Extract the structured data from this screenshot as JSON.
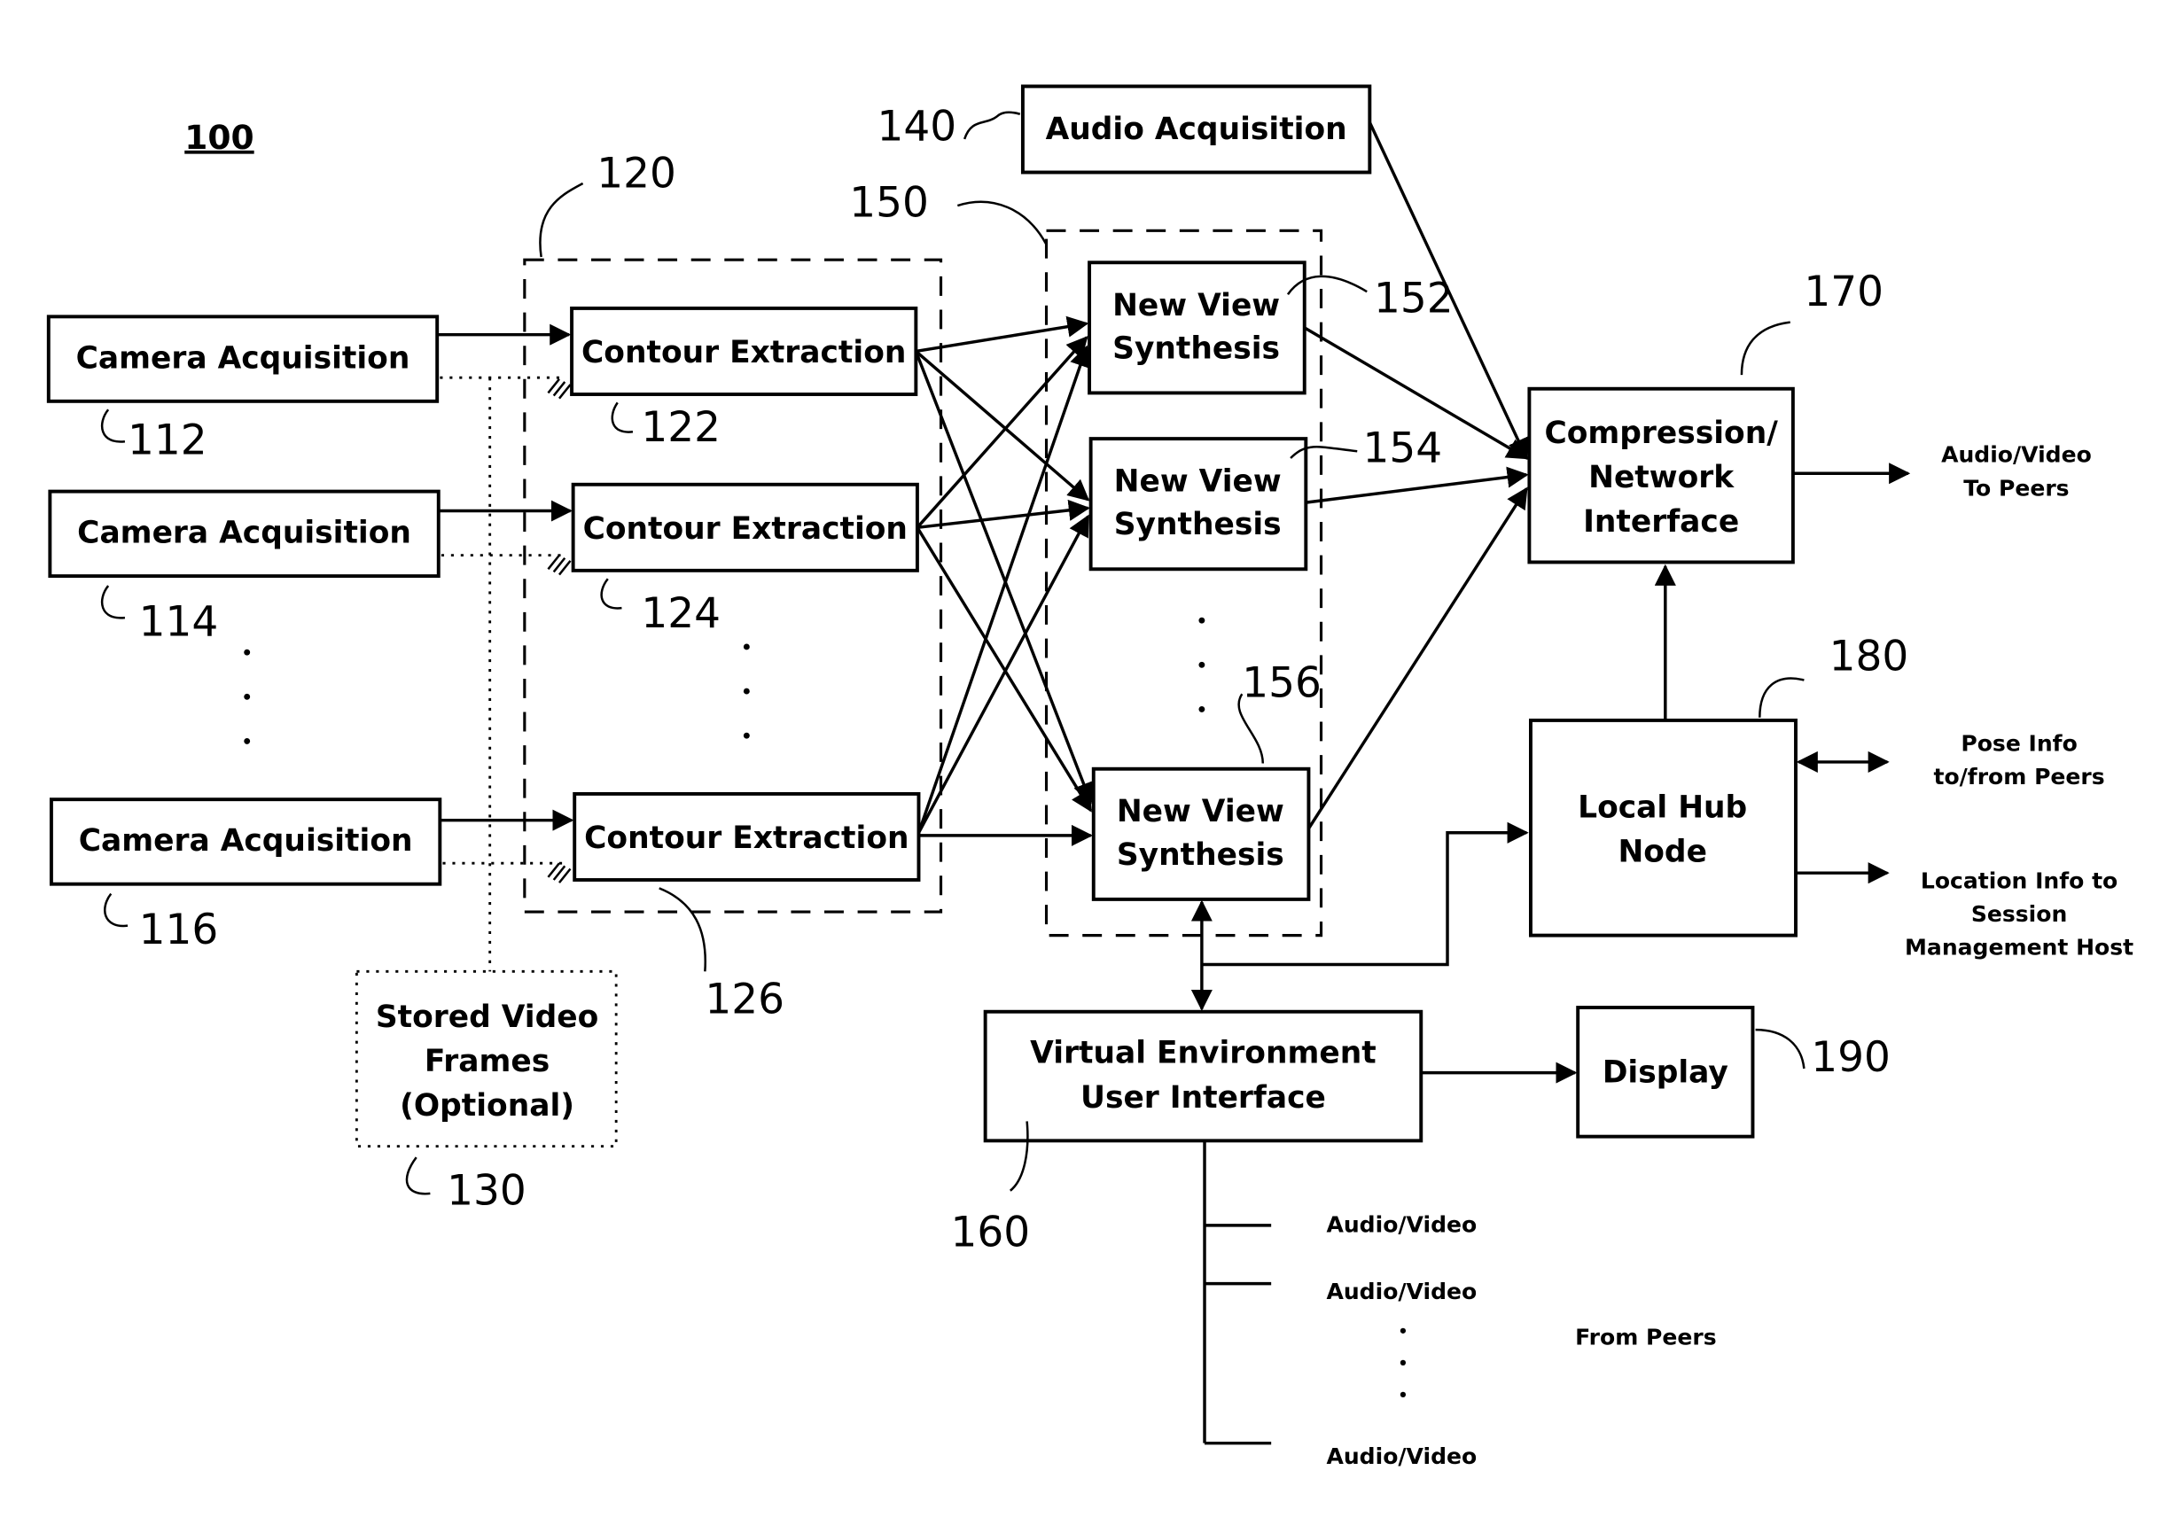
{
  "figure": {
    "number": "100"
  },
  "cameras": [
    {
      "label": "Camera Acquisition",
      "ref": "112"
    },
    {
      "label": "Camera Acquisition",
      "ref": "114"
    },
    {
      "label": "Camera Acquisition",
      "ref": "116"
    }
  ],
  "contour_group": {
    "ref": "120"
  },
  "contours": [
    {
      "label": "Contour Extraction",
      "ref": "122"
    },
    {
      "label": "Contour Extraction",
      "ref": "124"
    },
    {
      "label": "Contour Extraction",
      "ref": "126"
    }
  ],
  "stored_frames": {
    "lines": [
      "Stored Video",
      "Frames",
      "(Optional)"
    ],
    "ref": "130"
  },
  "audio": {
    "label": "Audio Acquisition",
    "ref": "140"
  },
  "synthesis_group": {
    "ref": "150"
  },
  "synthesis": [
    {
      "lines": [
        "New View",
        "Synthesis"
      ],
      "ref": "152"
    },
    {
      "lines": [
        "New View",
        "Synthesis"
      ],
      "ref": "154"
    },
    {
      "lines": [
        "New View",
        "Synthesis"
      ],
      "ref": "156"
    }
  ],
  "vui": {
    "lines": [
      "Virtual Environment",
      "User Interface"
    ],
    "ref": "160"
  },
  "compression": {
    "lines": [
      "Compression/",
      "Network",
      "Interface"
    ],
    "ref": "170"
  },
  "hub": {
    "lines": [
      "Local Hub",
      "Node"
    ],
    "ref": "180"
  },
  "display": {
    "label": "Display",
    "ref": "190"
  },
  "outputs": {
    "av_to_peers": [
      "Audio/Video",
      "To Peers"
    ],
    "pose": [
      "Pose Info",
      "to/from Peers"
    ],
    "location": [
      "Location Info to",
      "Session",
      "Management Host"
    ]
  },
  "peer_inputs": {
    "items": [
      "Audio/Video",
      "Audio/Video",
      "Audio/Video"
    ],
    "group_label": "From Peers"
  }
}
